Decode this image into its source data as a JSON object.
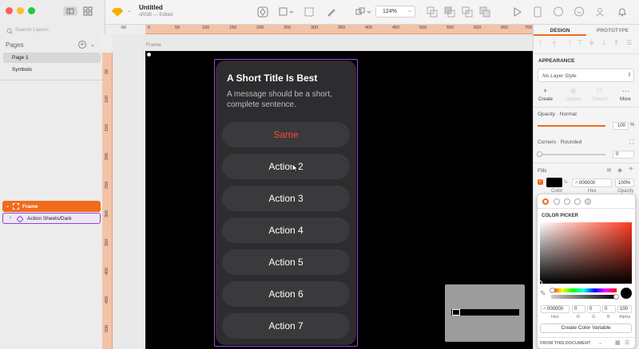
{
  "window": {
    "title": "Untitled",
    "subtitle": "sRGB — Edited",
    "zoom": "124%"
  },
  "sidebar": {
    "search_placeholder": "Search Layers",
    "pages_label": "Pages",
    "pages": [
      {
        "label": "Page 1",
        "selected": true
      },
      {
        "label": "Symbols",
        "selected": false
      }
    ],
    "layers": [
      {
        "label": "Frame",
        "selected": true
      },
      {
        "label": "Action Sheets/Dark",
        "selected": false
      }
    ]
  },
  "rulers": {
    "horizontal": [
      "-50",
      "0",
      "50",
      "100",
      "150",
      "200",
      "250",
      "300",
      "350",
      "400",
      "450",
      "500",
      "550",
      "600",
      "650",
      "700"
    ],
    "vertical": [
      "50",
      "100",
      "150",
      "200",
      "250",
      "300",
      "350",
      "400",
      "450",
      "500"
    ]
  },
  "canvas": {
    "frame_label": "Frame",
    "sheet": {
      "title": "A Short Title Is Best",
      "message": "A message should be a short, complete sentence.",
      "actions": [
        {
          "label": "Same",
          "destructive": true
        },
        {
          "label": "Action 2",
          "destructive": false
        },
        {
          "label": "Action 3",
          "destructive": false
        },
        {
          "label": "Action 4",
          "destructive": false
        },
        {
          "label": "Action 5",
          "destructive": false
        },
        {
          "label": "Action 6",
          "destructive": false
        },
        {
          "label": "Action 7",
          "destructive": false
        }
      ]
    }
  },
  "inspector": {
    "tabs": [
      "DESIGN",
      "PROTOTYPE"
    ],
    "appearance_label": "APPEARANCE",
    "layer_style": "No Layer Style",
    "style_actions": [
      "Create",
      "Update",
      "Detach",
      "More"
    ],
    "opacity_label": "Opacity · Normal",
    "opacity_value": "100",
    "opacity_unit": "%",
    "corners_label": "Corners · Rounded",
    "corners_value": "0",
    "fills_label": "Fills",
    "fill": {
      "hex": "000000",
      "opacity": "100%",
      "labels": [
        "Color",
        "Hex",
        "Opacity"
      ]
    },
    "color_picker": {
      "title": "COLOR PICKER",
      "hex": "000000",
      "r": "0",
      "g": "0",
      "b": "0",
      "alpha": "100",
      "labels": [
        "Hex",
        "R",
        "G",
        "B",
        "Alpha"
      ],
      "create_variable": "Create Color Variable",
      "footer": "FROM THIS DOCUMENT"
    }
  },
  "colors": {
    "accent": "#f26a1b",
    "selection": "#a24be0",
    "destructive": "#ff453a",
    "sheet_bg": "#2d2d2f",
    "button_bg": "#3a3a3c"
  }
}
